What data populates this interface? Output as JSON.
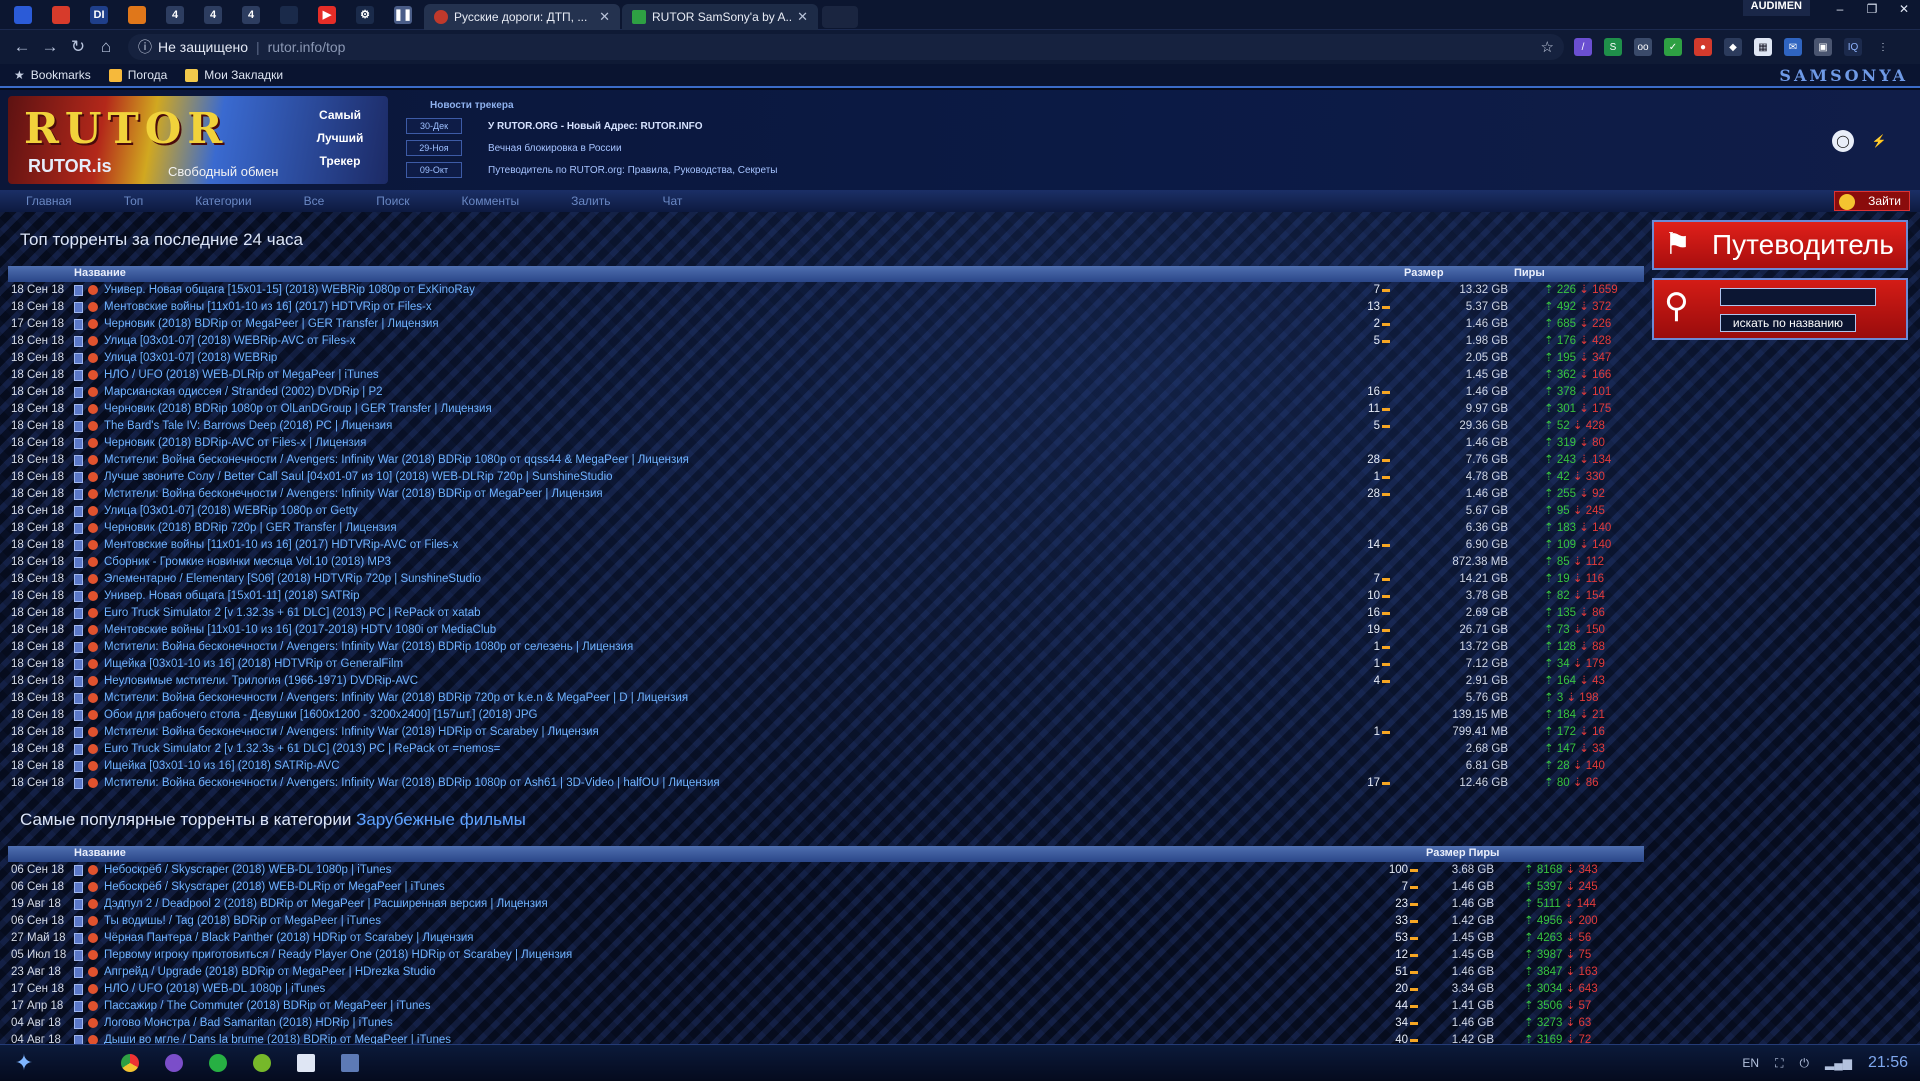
{
  "browser": {
    "pinned_tabs": [
      "icon-1",
      "icon-2",
      "icon-3",
      "icon-4",
      "4",
      "4",
      "4",
      "icon-8",
      "youtube",
      "icon-10",
      "icon-11"
    ],
    "tabs": [
      {
        "label": "Русские дороги: ДТП, ...",
        "active": false,
        "favicon_color": "#c0392b"
      },
      {
        "label": "RUTOR SamSony'a by A...",
        "active": true,
        "favicon_color": "#2ea043"
      }
    ],
    "profile": "AUDIMEN",
    "security_text": "Не защищено",
    "url": "rutor.info/top",
    "bookmarks": [
      "Bookmarks",
      "Погода",
      "Мои Закладки"
    ],
    "theme_label": "SAMSONYA"
  },
  "header": {
    "logo_big": "RUTOR",
    "logo_small": "RUTOR.is",
    "logo_sub": "Свободный обмен",
    "logo_side": [
      "Самый",
      "Лучший",
      "Трекер"
    ],
    "news_title": "Новости трекера",
    "news": [
      {
        "date": "30-Дек",
        "text": "У RUTOR.ORG - Новый Адрес: RUTOR.INFO",
        "bold": true
      },
      {
        "date": "29-Ноя",
        "text": "Вечная блокировка в России",
        "bold": false
      },
      {
        "date": "09-Окт",
        "text": "Путеводитель по RUTOR.org: Правила, Руководства, Секреты",
        "bold": false
      }
    ]
  },
  "menu": [
    "Главная",
    "Топ",
    "Категории",
    "Все",
    "Поиск",
    "Комменты",
    "Залить",
    "Чат"
  ],
  "login_label": "Зайти",
  "side": {
    "guide": "Путеводитель",
    "search_button": "искать по названию",
    "search_value": ""
  },
  "top24": {
    "title": "Топ торренты за последние 24 часа",
    "col_name": "Название",
    "col_size": "Размер",
    "col_peers": "Пиры",
    "rows": [
      {
        "date": "18 Сен 18",
        "title": "Универ. Новая общага [15x01-15] (2018) WEBRip 1080p от ExKinoRay",
        "comments": "7",
        "size": "13.32 GB",
        "up": "226",
        "down": "1659"
      },
      {
        "date": "18 Сен 18",
        "title": "Ментовские войны [11x01-10 из 16] (2017) HDTVRip от Files-x",
        "comments": "13",
        "size": "5.37 GB",
        "up": "492",
        "down": "372"
      },
      {
        "date": "17 Сен 18",
        "title": "Черновик (2018) BDRip от MegaPeer | GER Transfer | Лицензия",
        "comments": "2",
        "size": "1.46 GB",
        "up": "685",
        "down": "226"
      },
      {
        "date": "18 Сен 18",
        "title": "Улица [03x01-07] (2018) WEBRip-AVC от Files-x",
        "comments": "5",
        "size": "1.98 GB",
        "up": "176",
        "down": "428"
      },
      {
        "date": "18 Сен 18",
        "title": "Улица [03x01-07] (2018) WEBRip",
        "comments": "",
        "size": "2.05 GB",
        "up": "195",
        "down": "347"
      },
      {
        "date": "18 Сен 18",
        "title": "НЛО / UFO (2018) WEB-DLRip от MegaPeer | iTunes",
        "comments": "",
        "size": "1.45 GB",
        "up": "362",
        "down": "166"
      },
      {
        "date": "18 Сен 18",
        "title": "Марсианская одиссея / Stranded (2002) DVDRip | P2",
        "comments": "16",
        "size": "1.46 GB",
        "up": "378",
        "down": "101"
      },
      {
        "date": "18 Сен 18",
        "title": "Черновик (2018) BDRip 1080p от OlLanDGroup | GER Transfer | Лицензия",
        "comments": "11",
        "size": "9.97 GB",
        "up": "301",
        "down": "175"
      },
      {
        "date": "18 Сен 18",
        "title": "The Bard's Tale IV: Barrows Deep (2018) PC | Лицензия",
        "comments": "5",
        "size": "29.36 GB",
        "up": "52",
        "down": "428"
      },
      {
        "date": "18 Сен 18",
        "title": "Черновик (2018) BDRip-AVC от Files-x | Лицензия",
        "comments": "",
        "size": "1.46 GB",
        "up": "319",
        "down": "80"
      },
      {
        "date": "18 Сен 18",
        "title": "Мстители: Война бесконечности / Avengers: Infinity War (2018) BDRip 1080p от qqss44 & MegaPeer | Лицензия",
        "comments": "28",
        "size": "7.76 GB",
        "up": "243",
        "down": "134"
      },
      {
        "date": "18 Сен 18",
        "title": "Лучше звоните Солу / Better Call Saul [04x01-07 из 10] (2018) WEB-DLRip 720p | SunshineStudio",
        "comments": "1",
        "size": "4.78 GB",
        "up": "42",
        "down": "330"
      },
      {
        "date": "18 Сен 18",
        "title": "Мстители: Война бесконечности / Avengers: Infinity War (2018) BDRip от MegaPeer | Лицензия",
        "comments": "28",
        "size": "1.46 GB",
        "up": "255",
        "down": "92"
      },
      {
        "date": "18 Сен 18",
        "title": "Улица [03x01-07] (2018) WEBRip 1080p от Getty",
        "comments": "",
        "size": "5.67 GB",
        "up": "95",
        "down": "245"
      },
      {
        "date": "18 Сен 18",
        "title": "Черновик (2018) BDRip 720p | GER Transfer | Лицензия",
        "comments": "",
        "size": "6.36 GB",
        "up": "183",
        "down": "140"
      },
      {
        "date": "18 Сен 18",
        "title": "Ментовские войны [11x01-10 из 16] (2017) HDTVRip-AVC от Files-x",
        "comments": "14",
        "size": "6.90 GB",
        "up": "109",
        "down": "140"
      },
      {
        "date": "18 Сен 18",
        "title": "Сборник - Громкие новинки месяца Vol.10 (2018) MP3",
        "comments": "",
        "size": "872.38 MB",
        "up": "85",
        "down": "112"
      },
      {
        "date": "18 Сен 18",
        "title": "Элементарно / Elementary [S06] (2018) HDTVRip 720p | SunshineStudio",
        "comments": "7",
        "size": "14.21 GB",
        "up": "19",
        "down": "116"
      },
      {
        "date": "18 Сен 18",
        "title": "Универ. Новая общага [15x01-11] (2018) SATRip",
        "comments": "10",
        "size": "3.78 GB",
        "up": "82",
        "down": "154"
      },
      {
        "date": "18 Сен 18",
        "title": "Euro Truck Simulator 2 [v 1.32.3s + 61 DLC] (2013) PC | RePack от xatab",
        "comments": "16",
        "size": "2.69 GB",
        "up": "135",
        "down": "86"
      },
      {
        "date": "18 Сен 18",
        "title": "Ментовские войны [11x01-10 из 16] (2017-2018) HDTV 1080i от MediaClub",
        "comments": "19",
        "size": "26.71 GB",
        "up": "73",
        "down": "150"
      },
      {
        "date": "18 Сен 18",
        "title": "Мстители: Война бесконечности / Avengers: Infinity War (2018) BDRip 1080p от селезень | Лицензия",
        "comments": "1",
        "size": "13.72 GB",
        "up": "128",
        "down": "88"
      },
      {
        "date": "18 Сен 18",
        "title": "Ищейка [03x01-10 из 16] (2018) HDTVRip от GeneralFilm",
        "comments": "1",
        "size": "7.12 GB",
        "up": "34",
        "down": "179"
      },
      {
        "date": "18 Сен 18",
        "title": "Неуловимые мстители. Трилогия (1966-1971) DVDRip-AVC",
        "comments": "4",
        "size": "2.91 GB",
        "up": "164",
        "down": "43"
      },
      {
        "date": "18 Сен 18",
        "title": "Мстители: Война бесконечности / Avengers: Infinity War (2018) BDRip 720p от k.e.n & MegaPeer | D | Лицензия",
        "comments": "",
        "size": "5.76 GB",
        "up": "3",
        "down": "198"
      },
      {
        "date": "18 Сен 18",
        "title": "Обои для рабочего стола - Девушки [1600x1200 - 3200x2400] [157шт.] (2018) JPG",
        "comments": "",
        "size": "139.15 MB",
        "up": "184",
        "down": "21"
      },
      {
        "date": "18 Сен 18",
        "title": "Мстители: Война бесконечности / Avengers: Infinity War (2018) HDRip от Scarabey | Лицензия",
        "comments": "1",
        "size": "799.41 MB",
        "up": "172",
        "down": "16"
      },
      {
        "date": "18 Сен 18",
        "title": "Euro Truck Simulator 2 [v 1.32.3s + 61 DLC] (2013) PC | RePack от =nemos=",
        "comments": "",
        "size": "2.68 GB",
        "up": "147",
        "down": "33"
      },
      {
        "date": "18 Сен 18",
        "title": "Ищейка [03x01-10 из 16] (2018) SATRip-AVC",
        "comments": "",
        "size": "6.81 GB",
        "up": "28",
        "down": "140"
      },
      {
        "date": "18 Сен 18",
        "title": "Мстители: Война бесконечности / Avengers: Infinity War (2018) BDRip 1080p от Ash61 | 3D-Video | halfOU | Лицензия",
        "comments": "17",
        "size": "12.46 GB",
        "up": "80",
        "down": "86"
      }
    ]
  },
  "popular": {
    "title_prefix": "Самые популярные торренты в категории",
    "title_category": "Зарубежные фильмы",
    "col_name": "Название",
    "col_sizepeers": "Размер Пиры",
    "rows": [
      {
        "date": "06 Сен 18",
        "title": "Небоскрёб / Skyscraper (2018) WEB-DL 1080p | iTunes",
        "comments": "100",
        "size": "3.68 GB",
        "up": "8168",
        "down": "343"
      },
      {
        "date": "06 Сен 18",
        "title": "Небоскрёб / Skyscraper (2018) WEB-DLRip от MegaPeer | iTunes",
        "comments": "7",
        "size": "1.46 GB",
        "up": "5397",
        "down": "245"
      },
      {
        "date": "19 Авг 18",
        "title": "Дэдпул 2 / Deadpool 2 (2018) BDRip от MegaPeer | Расширенная версия | Лицензия",
        "comments": "23",
        "size": "1.46 GB",
        "up": "5111",
        "down": "144"
      },
      {
        "date": "06 Сен 18",
        "title": "Ты водишь! / Tag (2018) BDRip от MegaPeer | iTunes",
        "comments": "33",
        "size": "1.42 GB",
        "up": "4956",
        "down": "200"
      },
      {
        "date": "27 Май 18",
        "title": "Чёрная Пантера / Black Panther (2018) HDRip от Scarabey | Лицензия",
        "comments": "53",
        "size": "1.45 GB",
        "up": "4263",
        "down": "56"
      },
      {
        "date": "05 Июл 18",
        "title": "Первому игроку приготовиться / Ready Player One (2018) HDRip от Scarabey | Лицензия",
        "comments": "12",
        "size": "1.45 GB",
        "up": "3987",
        "down": "75"
      },
      {
        "date": "23 Авг 18",
        "title": "Апгрейд / Upgrade (2018) BDRip от MegaPeer | HDrezka Studio",
        "comments": "51",
        "size": "1.46 GB",
        "up": "3847",
        "down": "163"
      },
      {
        "date": "17 Сен 18",
        "title": "НЛО / UFO (2018) WEB-DL 1080p | iTunes",
        "comments": "20",
        "size": "3.34 GB",
        "up": "3034",
        "down": "643"
      },
      {
        "date": "17 Апр 18",
        "title": "Пассажир / The Commuter (2018) BDRip от MegaPeer | iTunes",
        "comments": "44",
        "size": "1.41 GB",
        "up": "3506",
        "down": "57"
      },
      {
        "date": "04 Авг 18",
        "title": "Логово Монстра / Bad Samaritan (2018) HDRip | iTunes",
        "comments": "34",
        "size": "1.46 GB",
        "up": "3273",
        "down": "63"
      },
      {
        "date": "04 Авг 18",
        "title": "Дыши во мгле / Dans la brume (2018) BDRip от MegaPeer | iTunes",
        "comments": "40",
        "size": "1.42 GB",
        "up": "3169",
        "down": "72"
      }
    ]
  },
  "taskbar": {
    "lang": "EN",
    "clock": "21:56"
  }
}
